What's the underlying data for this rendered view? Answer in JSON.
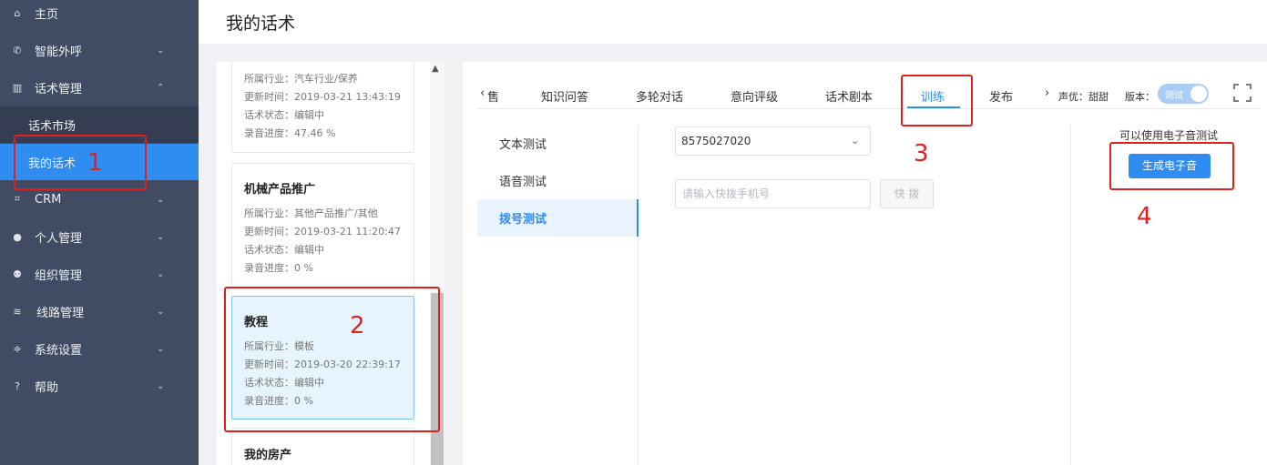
{
  "sidebar": {
    "items": [
      {
        "icon": "home-icon",
        "glyph": "⌂",
        "label": "主页"
      },
      {
        "icon": "phone-icon",
        "glyph": "✆",
        "label": "智能外呼",
        "chevron": "⌄"
      },
      {
        "icon": "book-icon",
        "glyph": "▥",
        "label": "话术管理",
        "chevron": "⌃"
      },
      {
        "icon": "crop-icon",
        "glyph": "⌗",
        "label": "CRM",
        "chevron": "⌄"
      },
      {
        "icon": "user-icon",
        "glyph": "●",
        "label": "个人管理",
        "chevron": "⌄"
      },
      {
        "icon": "users-icon",
        "glyph": "⚉",
        "label": "组织管理",
        "chevron": "⌄"
      },
      {
        "icon": "route-icon",
        "glyph": "≋",
        "label": "线路管理",
        "chevron": "⌄"
      },
      {
        "icon": "sliders-icon",
        "glyph": "≑",
        "label": "系统设置",
        "chevron": "⌄"
      },
      {
        "icon": "help-icon",
        "glyph": "?",
        "label": "帮助",
        "chevron": "⌄"
      }
    ],
    "subitems": [
      "话术市场",
      "我的话术"
    ]
  },
  "header": {
    "title": "我的话术"
  },
  "cards": [
    {
      "title": "",
      "industry": "所属行业：汽车行业/保养",
      "updated": "更新时间：2019-03-21 13:43:19",
      "status": "话术状态：编辑中",
      "progress": "录音进度：47.46 %"
    },
    {
      "title": "机械产品推广",
      "industry": "所属行业：其他产品推广/其他",
      "updated": "更新时间：2019-03-21 11:20:47",
      "status": "话术状态：编辑中",
      "progress": "录音进度：0 %"
    },
    {
      "title": "教程",
      "industry": "所属行业：模板",
      "updated": "更新时间：2019-03-20 22:39:17",
      "status": "话术状态：编辑中",
      "progress": "录音进度：0 %"
    },
    {
      "title": "我的房产"
    }
  ],
  "tabs": {
    "prev": "‹",
    "cutoff": "售",
    "items": [
      "知识问答",
      "多轮对话",
      "意向评级",
      "话术剧本",
      "训练",
      "发布"
    ],
    "next": "›",
    "voice": "声优：甜甜",
    "version_label": "版本：",
    "version_toggle": "测试"
  },
  "subnav": [
    "文本测试",
    "语音测试",
    "拨号测试"
  ],
  "dial": {
    "select_value": "8575027020",
    "input_placeholder": "请输入快拨手机号",
    "quick_dial": "快 拨"
  },
  "electronic": {
    "hint": "可以使用电子音测试",
    "button": "生成电子音"
  },
  "annotations": [
    "1",
    "2",
    "3",
    "4"
  ]
}
